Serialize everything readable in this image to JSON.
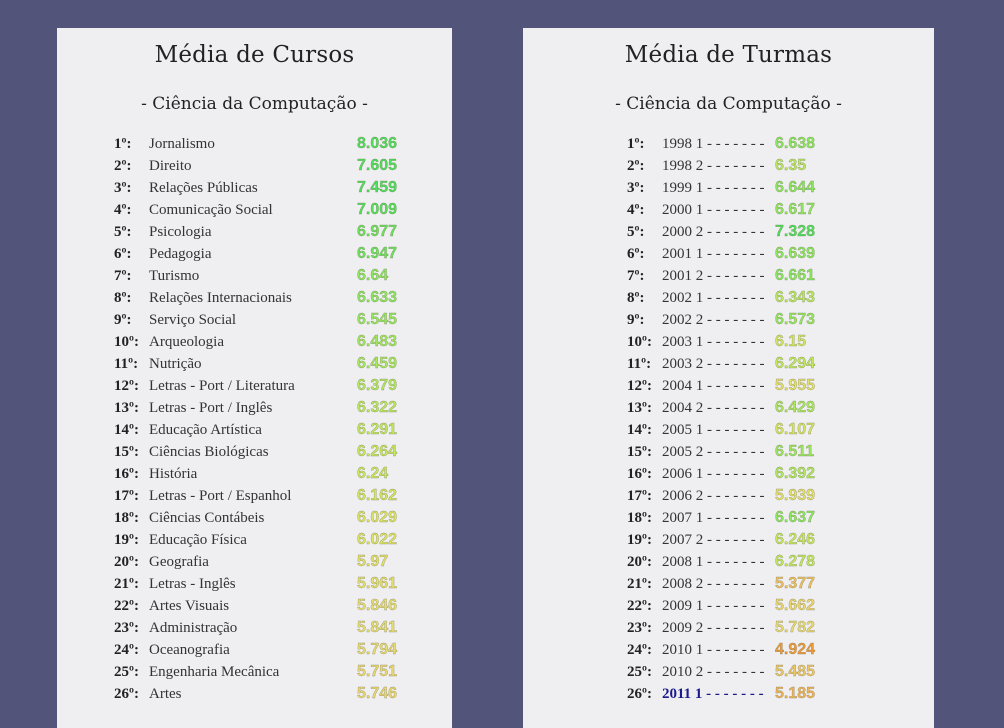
{
  "colors": {
    "background": "#535479",
    "panel": "#efeff1",
    "score_high": "#4fe05a",
    "score_midhigh": "#8be85e",
    "score_mid": "#c9e85c",
    "score_low": "#eae071",
    "score_lower": "#f0cd6a",
    "score_lowest": "#ef9b3a",
    "highlight_text": "#1a1a8c"
  },
  "cursos": {
    "title": "Média de Cursos",
    "subtitle": "- Ciência da Computação -",
    "rows": [
      {
        "rank": "1º:",
        "name": "Jornalismo",
        "score": "8.036",
        "color": "#4fe05a"
      },
      {
        "rank": "2º:",
        "name": "Direito",
        "score": "7.605",
        "color": "#4fe05a"
      },
      {
        "rank": "3º:",
        "name": "Relações Públicas",
        "score": "7.459",
        "color": "#4fe05a"
      },
      {
        "rank": "4º:",
        "name": "Comunicação Social",
        "score": "7.009",
        "color": "#55e05a"
      },
      {
        "rank": "5º:",
        "name": "Psicologia",
        "score": "6.977",
        "color": "#6be35b"
      },
      {
        "rank": "6º:",
        "name": "Pedagogia",
        "score": "6.947",
        "color": "#6be35b"
      },
      {
        "rank": "7º:",
        "name": "Turismo",
        "score": "6.64",
        "color": "#8be85e"
      },
      {
        "rank": "8º:",
        "name": "Relações Internacionais",
        "score": "6.633",
        "color": "#8be85e"
      },
      {
        "rank": "9º:",
        "name": "Serviço Social",
        "score": "6.545",
        "color": "#95e85e"
      },
      {
        "rank": "10º:",
        "name": "Arqueologia",
        "score": "6.483",
        "color": "#9fe85e"
      },
      {
        "rank": "11º:",
        "name": "Nutrição",
        "score": "6.459",
        "color": "#a6e85e"
      },
      {
        "rank": "12º:",
        "name": "Letras - Port / Literatura",
        "score": "6.379",
        "color": "#b2e85d"
      },
      {
        "rank": "13º:",
        "name": "Letras - Port / Inglês",
        "score": "6.322",
        "color": "#bae85d"
      },
      {
        "rank": "14º:",
        "name": "Educação Artística",
        "score": "6.291",
        "color": "#c1e85c"
      },
      {
        "rank": "15º:",
        "name": "Ciências Biológicas",
        "score": "6.264",
        "color": "#c6e85c"
      },
      {
        "rank": "16º:",
        "name": "História",
        "score": "6.24",
        "color": "#c9e85c"
      },
      {
        "rank": "17º:",
        "name": "Letras - Port / Espanhol",
        "score": "6.162",
        "color": "#d2e65e"
      },
      {
        "rank": "18º:",
        "name": "Ciências Contábeis",
        "score": "6.029",
        "color": "#dde462"
      },
      {
        "rank": "19º:",
        "name": "Educação Física",
        "score": "6.022",
        "color": "#dde462"
      },
      {
        "rank": "20º:",
        "name": "Geografia",
        "score": "5.97",
        "color": "#e2e167"
      },
      {
        "rank": "21º:",
        "name": "Letras - Inglês",
        "score": "5.961",
        "color": "#e4e06b"
      },
      {
        "rank": "22º:",
        "name": "Artes Visuais",
        "score": "5.846",
        "color": "#e8de70"
      },
      {
        "rank": "23º:",
        "name": "Administração",
        "score": "5.841",
        "color": "#e8de70"
      },
      {
        "rank": "24º:",
        "name": "Oceanografia",
        "score": "5.794",
        "color": "#eadb70"
      },
      {
        "rank": "25º:",
        "name": "Engenharia Mecânica",
        "score": "5.751",
        "color": "#ebd86e"
      },
      {
        "rank": "26º:",
        "name": "Artes",
        "score": "5.746",
        "color": "#ebd86e"
      }
    ]
  },
  "turmas": {
    "title": "Média de Turmas",
    "subtitle": "- Ciência da Computação -",
    "rows": [
      {
        "rank": "1º:",
        "period": "1998 1 - - - - - - -",
        "score": "6.638",
        "color": "#8be85e"
      },
      {
        "rank": "2º:",
        "period": "1998 2 - - - - - - -",
        "score": "6.35",
        "color": "#b8e85d"
      },
      {
        "rank": "3º:",
        "period": "1999 1 - - - - - - -",
        "score": "6.644",
        "color": "#8be85e"
      },
      {
        "rank": "4º:",
        "period": "2000 1 - - - - - - -",
        "score": "6.617",
        "color": "#8fe85e"
      },
      {
        "rank": "5º:",
        "period": "2000 2 - - - - - - -",
        "score": "7.328",
        "color": "#4fe05a"
      },
      {
        "rank": "6º:",
        "period": "2001 1 - - - - - - -",
        "score": "6.639",
        "color": "#8be85e"
      },
      {
        "rank": "7º:",
        "period": "2001 2 - - - - - - -",
        "score": "6.661",
        "color": "#88e85e"
      },
      {
        "rank": "8º:",
        "period": "2002 1 - - - - - - -",
        "score": "6.343",
        "color": "#b8e85d"
      },
      {
        "rank": "9º:",
        "period": "2002 2 - - - - - - -",
        "score": "6.573",
        "color": "#95e85e"
      },
      {
        "rank": "10º:",
        "period": "2003 1 - - - - - - -",
        "score": "6.15",
        "color": "#d2e65e"
      },
      {
        "rank": "11º:",
        "period": "2003 2 - - - - - - -",
        "score": "6.294",
        "color": "#c1e85c"
      },
      {
        "rank": "12º:",
        "period": "2004 1 - - - - - - -",
        "score": "5.955",
        "color": "#e4e06b"
      },
      {
        "rank": "13º:",
        "period": "2004 2 - - - - - - -",
        "score": "6.429",
        "color": "#a9e85e"
      },
      {
        "rank": "14º:",
        "period": "2005 1 - - - - - - -",
        "score": "6.107",
        "color": "#d6e55f"
      },
      {
        "rank": "15º:",
        "period": "2005 2 - - - - - - -",
        "score": "6.511",
        "color": "#9be85e"
      },
      {
        "rank": "16º:",
        "period": "2006 1 - - - - - - -",
        "score": "6.392",
        "color": "#b0e85d"
      },
      {
        "rank": "17º:",
        "period": "2006 2 - - - - - - -",
        "score": "5.939",
        "color": "#e4e06b"
      },
      {
        "rank": "18º:",
        "period": "2007 1 - - - - - - -",
        "score": "6.637",
        "color": "#8be85e"
      },
      {
        "rank": "19º:",
        "period": "2007 2 - - - - - - -",
        "score": "6.246",
        "color": "#c6e85c"
      },
      {
        "rank": "20º:",
        "period": "2008 1 - - - - - - -",
        "score": "6.278",
        "color": "#c1e85c"
      },
      {
        "rank": "21º:",
        "period": "2008 2 - - - - - - -",
        "score": "5.377",
        "color": "#f0c060"
      },
      {
        "rank": "22º:",
        "period": "2009 1 - - - - - - -",
        "score": "5.662",
        "color": "#ecd66c"
      },
      {
        "rank": "23º:",
        "period": "2009 2 - - - - - - -",
        "score": "5.782",
        "color": "#eadb70"
      },
      {
        "rank": "24º:",
        "period": "2010 1 - - - - - - -",
        "score": "4.924",
        "color": "#ef9b3a"
      },
      {
        "rank": "25º:",
        "period": "2010 2 - - - - - - -",
        "score": "5.485",
        "color": "#efc865"
      },
      {
        "rank": "26º:",
        "period": "2011 1 - - - - - - -",
        "score": "5.185",
        "color": "#f0b457",
        "highlight": true
      }
    ]
  }
}
